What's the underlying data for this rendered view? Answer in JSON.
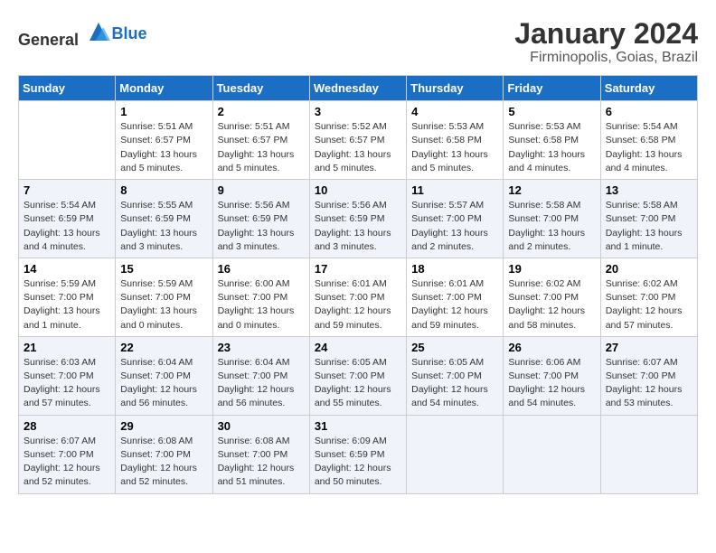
{
  "header": {
    "logo_general": "General",
    "logo_blue": "Blue",
    "month": "January 2024",
    "location": "Firminopolis, Goias, Brazil"
  },
  "days_of_week": [
    "Sunday",
    "Monday",
    "Tuesday",
    "Wednesday",
    "Thursday",
    "Friday",
    "Saturday"
  ],
  "weeks": [
    [
      {
        "date": "",
        "info": ""
      },
      {
        "date": "1",
        "info": "Sunrise: 5:51 AM\nSunset: 6:57 PM\nDaylight: 13 hours\nand 5 minutes."
      },
      {
        "date": "2",
        "info": "Sunrise: 5:51 AM\nSunset: 6:57 PM\nDaylight: 13 hours\nand 5 minutes."
      },
      {
        "date": "3",
        "info": "Sunrise: 5:52 AM\nSunset: 6:57 PM\nDaylight: 13 hours\nand 5 minutes."
      },
      {
        "date": "4",
        "info": "Sunrise: 5:53 AM\nSunset: 6:58 PM\nDaylight: 13 hours\nand 5 minutes."
      },
      {
        "date": "5",
        "info": "Sunrise: 5:53 AM\nSunset: 6:58 PM\nDaylight: 13 hours\nand 4 minutes."
      },
      {
        "date": "6",
        "info": "Sunrise: 5:54 AM\nSunset: 6:58 PM\nDaylight: 13 hours\nand 4 minutes."
      }
    ],
    [
      {
        "date": "7",
        "info": "Sunrise: 5:54 AM\nSunset: 6:59 PM\nDaylight: 13 hours\nand 4 minutes."
      },
      {
        "date": "8",
        "info": "Sunrise: 5:55 AM\nSunset: 6:59 PM\nDaylight: 13 hours\nand 3 minutes."
      },
      {
        "date": "9",
        "info": "Sunrise: 5:56 AM\nSunset: 6:59 PM\nDaylight: 13 hours\nand 3 minutes."
      },
      {
        "date": "10",
        "info": "Sunrise: 5:56 AM\nSunset: 6:59 PM\nDaylight: 13 hours\nand 3 minutes."
      },
      {
        "date": "11",
        "info": "Sunrise: 5:57 AM\nSunset: 7:00 PM\nDaylight: 13 hours\nand 2 minutes."
      },
      {
        "date": "12",
        "info": "Sunrise: 5:58 AM\nSunset: 7:00 PM\nDaylight: 13 hours\nand 2 minutes."
      },
      {
        "date": "13",
        "info": "Sunrise: 5:58 AM\nSunset: 7:00 PM\nDaylight: 13 hours\nand 1 minute."
      }
    ],
    [
      {
        "date": "14",
        "info": "Sunrise: 5:59 AM\nSunset: 7:00 PM\nDaylight: 13 hours\nand 1 minute."
      },
      {
        "date": "15",
        "info": "Sunrise: 5:59 AM\nSunset: 7:00 PM\nDaylight: 13 hours\nand 0 minutes."
      },
      {
        "date": "16",
        "info": "Sunrise: 6:00 AM\nSunset: 7:00 PM\nDaylight: 13 hours\nand 0 minutes."
      },
      {
        "date": "17",
        "info": "Sunrise: 6:01 AM\nSunset: 7:00 PM\nDaylight: 12 hours\nand 59 minutes."
      },
      {
        "date": "18",
        "info": "Sunrise: 6:01 AM\nSunset: 7:00 PM\nDaylight: 12 hours\nand 59 minutes."
      },
      {
        "date": "19",
        "info": "Sunrise: 6:02 AM\nSunset: 7:00 PM\nDaylight: 12 hours\nand 58 minutes."
      },
      {
        "date": "20",
        "info": "Sunrise: 6:02 AM\nSunset: 7:00 PM\nDaylight: 12 hours\nand 57 minutes."
      }
    ],
    [
      {
        "date": "21",
        "info": "Sunrise: 6:03 AM\nSunset: 7:00 PM\nDaylight: 12 hours\nand 57 minutes."
      },
      {
        "date": "22",
        "info": "Sunrise: 6:04 AM\nSunset: 7:00 PM\nDaylight: 12 hours\nand 56 minutes."
      },
      {
        "date": "23",
        "info": "Sunrise: 6:04 AM\nSunset: 7:00 PM\nDaylight: 12 hours\nand 56 minutes."
      },
      {
        "date": "24",
        "info": "Sunrise: 6:05 AM\nSunset: 7:00 PM\nDaylight: 12 hours\nand 55 minutes."
      },
      {
        "date": "25",
        "info": "Sunrise: 6:05 AM\nSunset: 7:00 PM\nDaylight: 12 hours\nand 54 minutes."
      },
      {
        "date": "26",
        "info": "Sunrise: 6:06 AM\nSunset: 7:00 PM\nDaylight: 12 hours\nand 54 minutes."
      },
      {
        "date": "27",
        "info": "Sunrise: 6:07 AM\nSunset: 7:00 PM\nDaylight: 12 hours\nand 53 minutes."
      }
    ],
    [
      {
        "date": "28",
        "info": "Sunrise: 6:07 AM\nSunset: 7:00 PM\nDaylight: 12 hours\nand 52 minutes."
      },
      {
        "date": "29",
        "info": "Sunrise: 6:08 AM\nSunset: 7:00 PM\nDaylight: 12 hours\nand 52 minutes."
      },
      {
        "date": "30",
        "info": "Sunrise: 6:08 AM\nSunset: 7:00 PM\nDaylight: 12 hours\nand 51 minutes."
      },
      {
        "date": "31",
        "info": "Sunrise: 6:09 AM\nSunset: 6:59 PM\nDaylight: 12 hours\nand 50 minutes."
      },
      {
        "date": "",
        "info": ""
      },
      {
        "date": "",
        "info": ""
      },
      {
        "date": "",
        "info": ""
      }
    ]
  ]
}
